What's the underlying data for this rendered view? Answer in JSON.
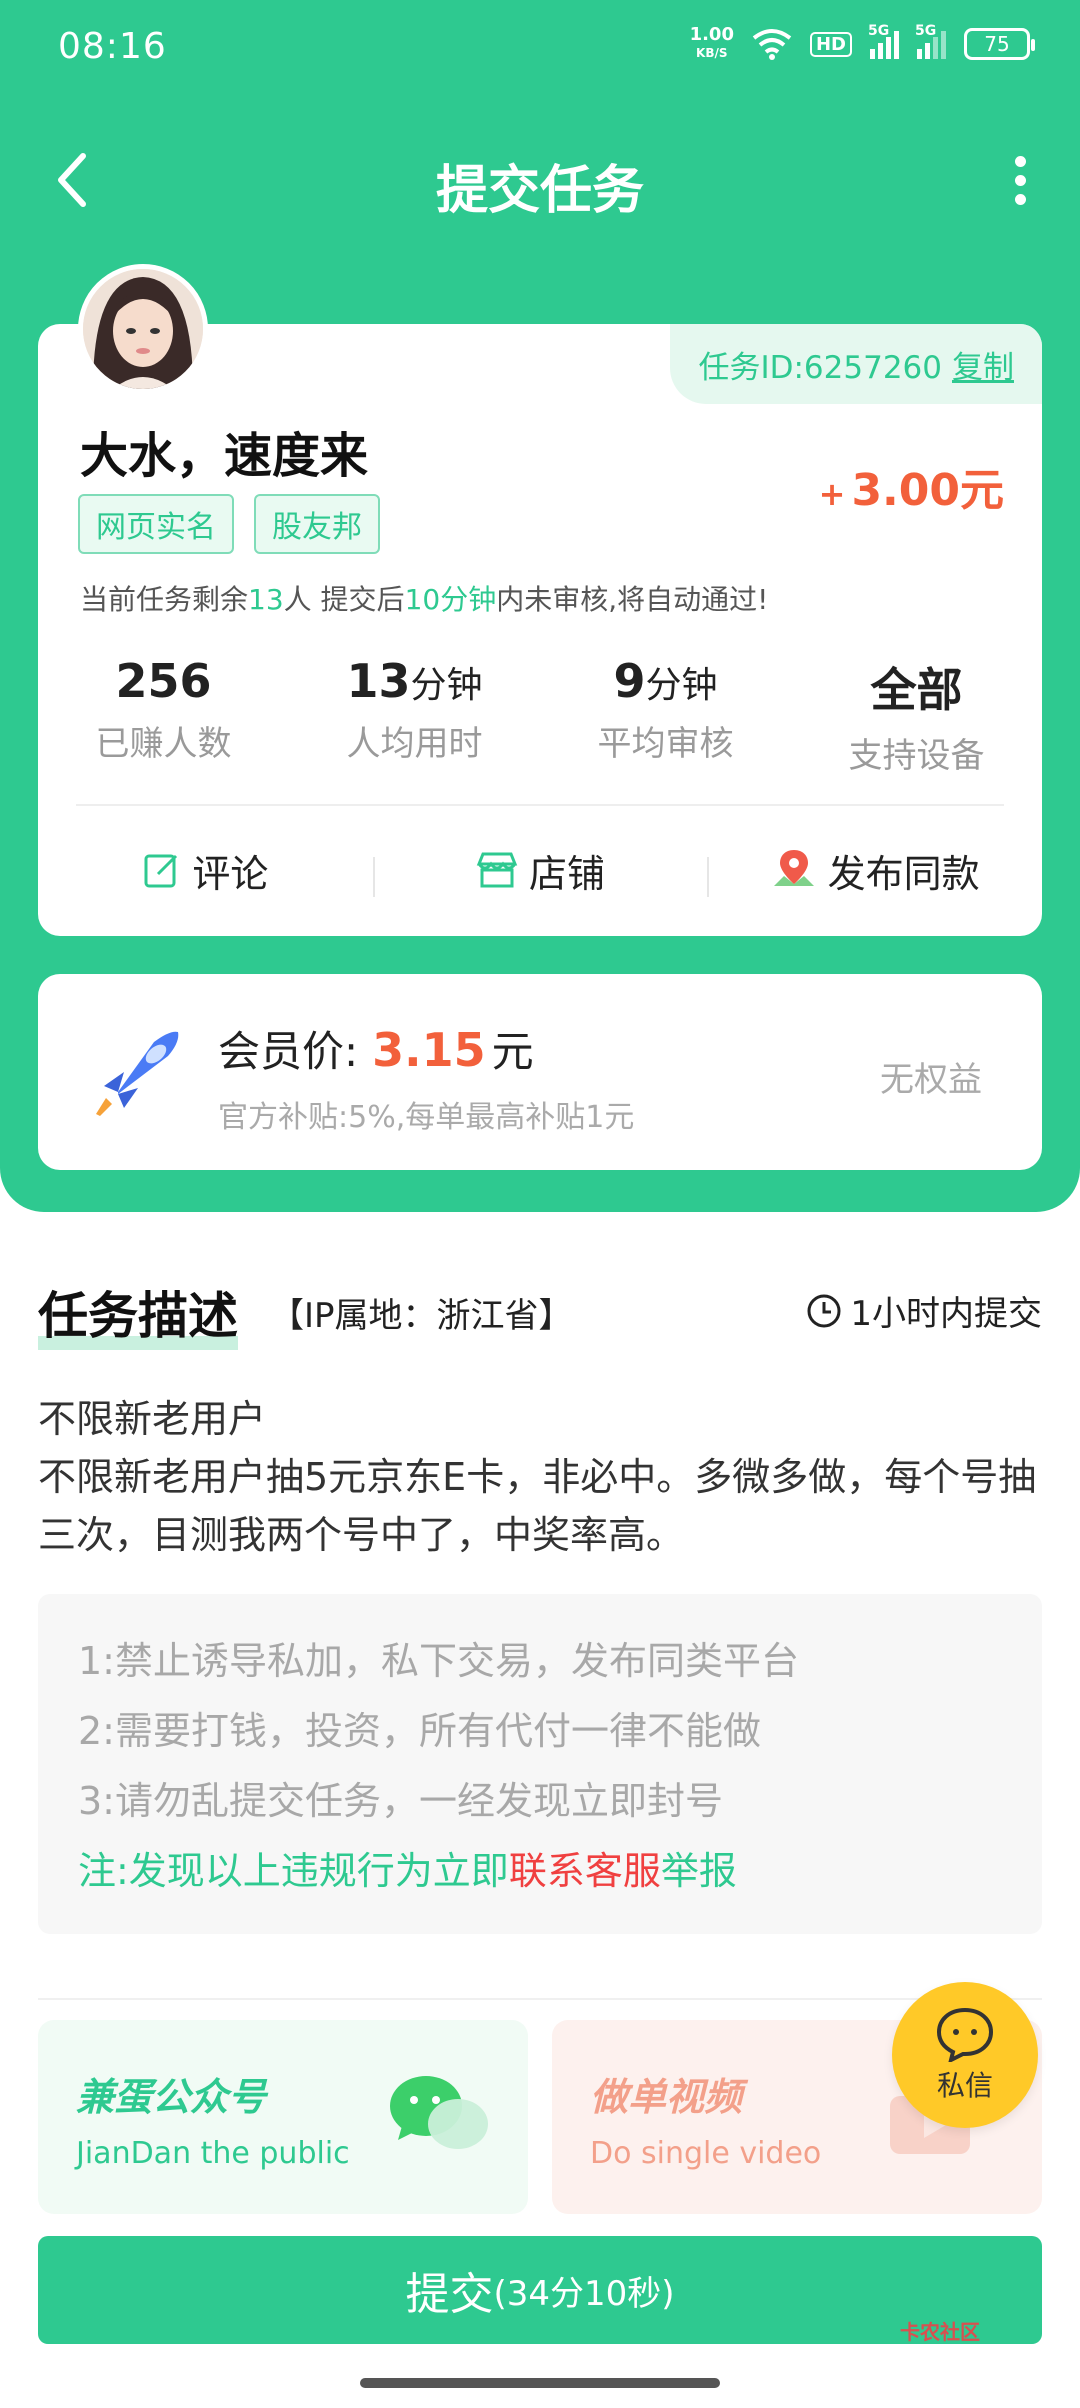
{
  "status": {
    "time": "08:16",
    "speed": "1.00",
    "speed_unit": "KB/S",
    "hd": "HD",
    "sig1": "5G",
    "sig2": "5G",
    "battery": "75"
  },
  "nav": {
    "title": "提交任务"
  },
  "task": {
    "id_label": "任务ID:6257260",
    "copy": "复制",
    "name": "大水，速度来",
    "reward_plus": "+",
    "reward": "3.00元",
    "tags": [
      "网页实名",
      "股友邦"
    ],
    "notice": {
      "p1": "当前任务剩余",
      "remain": "13",
      "p2": "人  提交后",
      "time": "10分钟",
      "p3": "内未审核,将自动通过!"
    },
    "stats": [
      {
        "value": "256",
        "unit": "",
        "label": "已赚人数"
      },
      {
        "value": "13",
        "unit": "分钟",
        "label": "人均用时"
      },
      {
        "value": "9",
        "unit": "分钟",
        "label": "平均审核"
      },
      {
        "value": "全部",
        "unit": "",
        "label": "支持设备"
      }
    ],
    "actions": {
      "comment": "评论",
      "shop": "店铺",
      "publish": "发布同款"
    }
  },
  "member": {
    "label": "会员价:",
    "price": "3.15",
    "unit": "元",
    "subsidy": "官方补贴:5%,每单最高补贴1元",
    "right": "无权益"
  },
  "description": {
    "title": "任务描述",
    "ip": "【IP属地：浙江省】",
    "deadline": "1小时内提交",
    "line1": "不限新老用户",
    "line2": "不限新老用户抽5元京东E卡，非必中。多微多做，每个号抽三次，目测我两个号中了，中奖率高。"
  },
  "rules": {
    "r1": "1:禁止诱导私加，私下交易，发布同类平台",
    "r2": "2:需要打钱，投资，所有代付一律不能做",
    "r3": "3:请勿乱提交任务，一经发现立即封号",
    "note_a": "注:发现以上违规行为立即",
    "note_b": "联系客服",
    "note_c": "举报"
  },
  "promos": {
    "wx_title": "兼蛋公众号",
    "wx_sub": "JianDan the public",
    "video_title": "做单视频",
    "video_sub": "Do single video"
  },
  "chat": {
    "label": "私信"
  },
  "submit": {
    "label": "提交",
    "countdown": "(34分10秒)"
  },
  "watermark": "卡农社区",
  "colors": {
    "brand": "#2ec990",
    "price": "#f2603b",
    "member_bg": "#ffffff",
    "chat": "#ffc928"
  }
}
